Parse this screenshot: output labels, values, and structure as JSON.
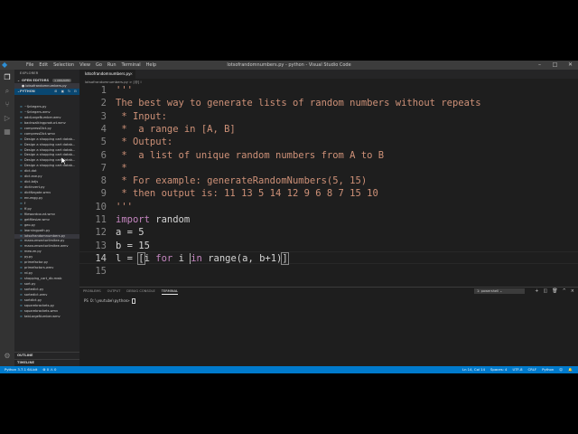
{
  "window": {
    "title": "lotsofrandomnumbers.py - python - Visual Studio Code",
    "menu": [
      "File",
      "Edit",
      "Selection",
      "View",
      "Go",
      "Run",
      "Terminal",
      "Help"
    ]
  },
  "sidebar": {
    "header": "EXPLORER",
    "open_editors_label": "OPEN EDITORS",
    "open_editors_badge": "1 UNSAVED",
    "open_file": "lotsofrandomnumbers.py",
    "folder": "PYTHON",
    "files": [
      "~$ntegers.py",
      "~$ntegers.wmv",
      "addLargeNumber.wmv",
      "backwalkingproduct.wmv",
      "compressDict.py",
      "compressDict.wmv",
      "Design a shopping cart datab...",
      "Design a shopping cart datab...",
      "Design a shopping cart datab...",
      "Design a shopping cart datab...",
      "Design a shopping cart datab...",
      "Design a shopping cart datab...",
      "dict.dat",
      "dict.exe.py",
      "dict.bdjs",
      "dictinvert.py",
      "dictNegate.wmv",
      "enumgg.py",
      "f",
      "ff.py",
      "filewordcount.wmv",
      "getfilesize.wmv",
      "geo.py",
      "learningpath.py",
      "lotsofrandomnumbers.py",
      "maxsumsectorlimitee.py",
      "maxsumsectorlimitee.wmv",
      "mesum.py",
      "py.py",
      "primefactor.py",
      "primefactors.wmv",
      "rd.py",
      "shopping_cart_db.mwb",
      "sort.py",
      "sortedict.py",
      "sortedict.wmv",
      "sortdict.py",
      "squarebrackets.py",
      "squarebrackets.wmv",
      "tabLargeNumber.wmv"
    ],
    "selected_file_index": 24,
    "outline": "OUTLINE",
    "timeline": "TIMELINE"
  },
  "editor": {
    "tab": "lotsofrandomnumbers.py",
    "breadcrumb": "lotsofrandomnumbers.py > [@] l",
    "lines": [
      {
        "n": "1",
        "t": "'''",
        "s": "str"
      },
      {
        "n": "2",
        "t": "The best way to generate lists of random numbers without repeats",
        "s": "str"
      },
      {
        "n": "3",
        "t": " * Input:",
        "s": "str"
      },
      {
        "n": "4",
        "t": " *  a range in [A, B]",
        "s": "str"
      },
      {
        "n": "5",
        "t": " * Output:",
        "s": "str"
      },
      {
        "n": "6",
        "t": " *  a list of unique random numbers from A to B",
        "s": "str"
      },
      {
        "n": "7",
        "t": " *",
        "s": "str"
      },
      {
        "n": "8",
        "t": " * For example: generateRandomNumbers(5, 15)",
        "s": "str"
      },
      {
        "n": "9",
        "t": " * then output is: 11 13 5 14 12 9 6 8 7 15 10",
        "s": "str"
      },
      {
        "n": "10",
        "t": "'''",
        "s": "str"
      },
      {
        "n": "11",
        "t": "import random",
        "s": "import"
      },
      {
        "n": "12",
        "t": "a = 5",
        "s": "plain"
      },
      {
        "n": "13",
        "t": "b = 15",
        "s": "plain"
      },
      {
        "n": "14",
        "t": "l = [i for i in range(a, b+1)]",
        "s": "listcomp"
      },
      {
        "n": "15",
        "t": "",
        "s": "plain"
      }
    ]
  },
  "panel": {
    "tabs": [
      "PROBLEMS",
      "OUTPUT",
      "DEBUG CONSOLE",
      "TERMINAL"
    ],
    "active_tab": "TERMINAL",
    "terminal_select": "1: powershell",
    "prompt": "PS D:\\youtube\\python> "
  },
  "statusbar": {
    "left": [
      "Python 3.7.1 64-bit",
      "⊗ 0 ⚠ 0"
    ],
    "right": [
      "Ln 14, Col 14",
      "Spaces: 4",
      "UTF-8",
      "CRLF",
      "Python"
    ]
  },
  "colors": {
    "accent": "#007acc",
    "string": "#ce9178",
    "keyword": "#c586c0"
  }
}
